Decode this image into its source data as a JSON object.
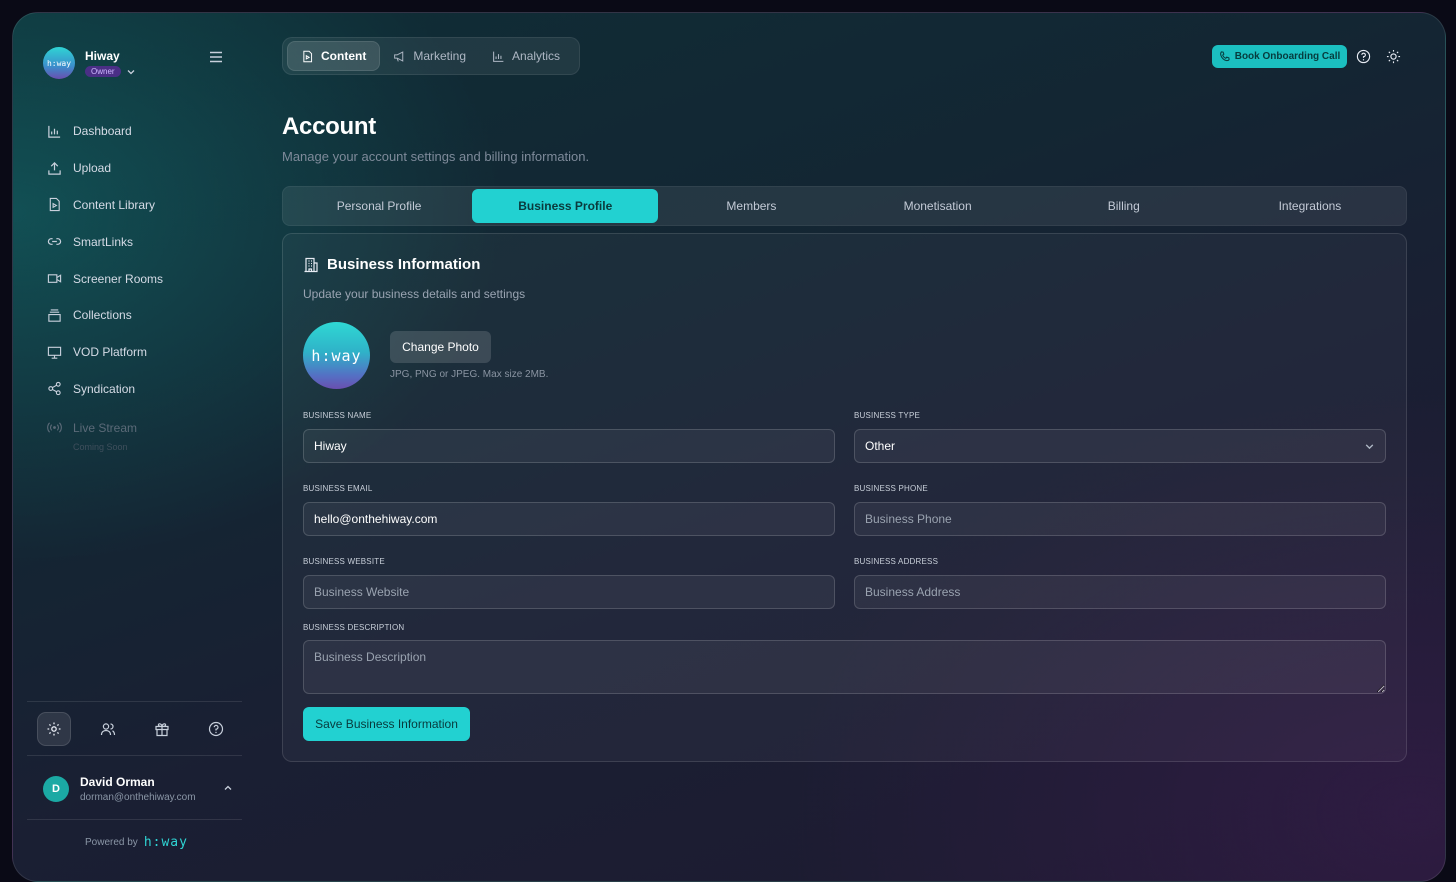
{
  "brand": {
    "name": "Hiway",
    "role": "Owner",
    "logo_text": "h:way"
  },
  "nav": [
    {
      "label": "Dashboard",
      "icon": "bar-chart-icon"
    },
    {
      "label": "Upload",
      "icon": "upload-icon"
    },
    {
      "label": "Content Library",
      "icon": "file-icon"
    },
    {
      "label": "SmartLinks",
      "icon": "link-icon"
    },
    {
      "label": "Screener Rooms",
      "icon": "video-icon"
    },
    {
      "label": "Collections",
      "icon": "stack-icon"
    },
    {
      "label": "VOD Platform",
      "icon": "monitor-icon"
    },
    {
      "label": "Syndication",
      "icon": "share-icon"
    },
    {
      "label": "Live Stream",
      "sub": "Coming Soon",
      "icon": "broadcast-icon"
    }
  ],
  "user": {
    "initial": "D",
    "name": "David Orman",
    "email": "dorman@onthehiway.com"
  },
  "powered": {
    "label": "Powered by",
    "logo": "h:way"
  },
  "topnav": [
    {
      "label": "Content",
      "icon": "file-icon"
    },
    {
      "label": "Marketing",
      "icon": "megaphone-icon"
    },
    {
      "label": "Analytics",
      "icon": "bar-chart-icon"
    }
  ],
  "header": {
    "book_label": "Book Onboarding Call"
  },
  "page": {
    "title": "Account",
    "subtitle": "Manage your account settings and billing information."
  },
  "tabs": [
    "Personal Profile",
    "Business Profile",
    "Members",
    "Monetisation",
    "Billing",
    "Integrations"
  ],
  "card": {
    "title": "Business Information",
    "subtitle": "Update your business details and settings",
    "photo_logo": "h:way",
    "change_photo": "Change Photo",
    "photo_note": "JPG, PNG or JPEG. Max size 2MB.",
    "save_label": "Save Business Information"
  },
  "fields": {
    "name": {
      "label": "BUSINESS NAME",
      "value": "Hiway",
      "placeholder": "Business Name"
    },
    "type": {
      "label": "BUSINESS TYPE",
      "value": "Other"
    },
    "email": {
      "label": "BUSINESS EMAIL",
      "value": "hello@onthehiway.com",
      "placeholder": "Business Email"
    },
    "phone": {
      "label": "BUSINESS PHONE",
      "value": "",
      "placeholder": "Business Phone"
    },
    "website": {
      "label": "BUSINESS WEBSITE",
      "value": "",
      "placeholder": "Business Website"
    },
    "address": {
      "label": "BUSINESS ADDRESS",
      "value": "",
      "placeholder": "Business Address"
    },
    "description": {
      "label": "BUSINESS DESCRIPTION",
      "value": "",
      "placeholder": "Business Description"
    }
  },
  "colors": {
    "accent": "#22d1d1",
    "owner_badge": "#4a2f86"
  }
}
